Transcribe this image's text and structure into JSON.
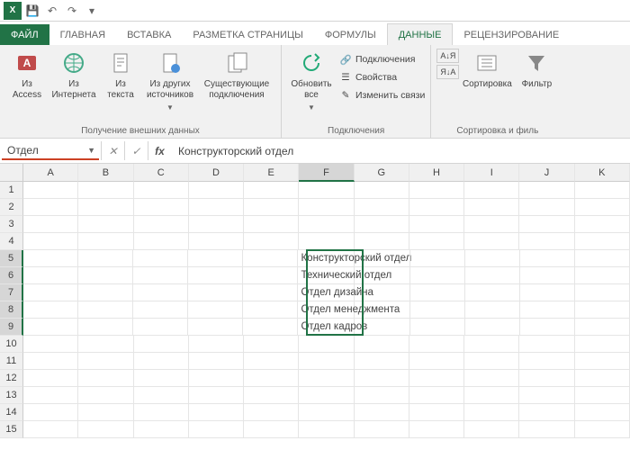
{
  "qat": {
    "app": "X",
    "save": "💾",
    "undo": "↶",
    "redo": "↷"
  },
  "tabs": {
    "file": "ФАЙЛ",
    "items": [
      "ГЛАВНАЯ",
      "ВСТАВКА",
      "РАЗМЕТКА СТРАНИЦЫ",
      "ФОРМУЛЫ",
      "ДАННЫЕ",
      "РЕЦЕНЗИРОВАНИЕ"
    ],
    "active": "ДАННЫЕ"
  },
  "ribbon": {
    "group1_label": "Получение внешних данных",
    "btn_access": "Из\nAccess",
    "btn_web": "Из\nИнтернета",
    "btn_text": "Из\nтекста",
    "btn_other": "Из других\nисточников",
    "btn_existing": "Существующие\nподключения",
    "group2_label": "Подключения",
    "btn_refresh": "Обновить\nвсе",
    "connections": "Подключения",
    "properties": "Свойства",
    "edit_links": "Изменить связи",
    "group3_label": "Сортировка и филь",
    "btn_sort_az": "А↓Я",
    "btn_sort_za": "Я↓А",
    "btn_sort": "Сортировка",
    "btn_filter": "Фильтр"
  },
  "formula": {
    "namebox": "Отдел",
    "fx": "fx",
    "value": "Конструкторский отдел"
  },
  "columns": [
    "A",
    "B",
    "C",
    "D",
    "E",
    "F",
    "G",
    "H",
    "I",
    "J",
    "K"
  ],
  "rows": [
    1,
    2,
    3,
    4,
    5,
    6,
    7,
    8,
    9,
    10,
    11,
    12,
    13,
    14,
    15
  ],
  "selected_col": "F",
  "selected_rows": [
    5,
    6,
    7,
    8,
    9
  ],
  "cells": {
    "F5": "Конструкторский отдел",
    "F6": "Технический отдел",
    "F7": "Отдел дизайна",
    "F8": "Отдел менеджмента",
    "F9": "Отдел кадров"
  }
}
